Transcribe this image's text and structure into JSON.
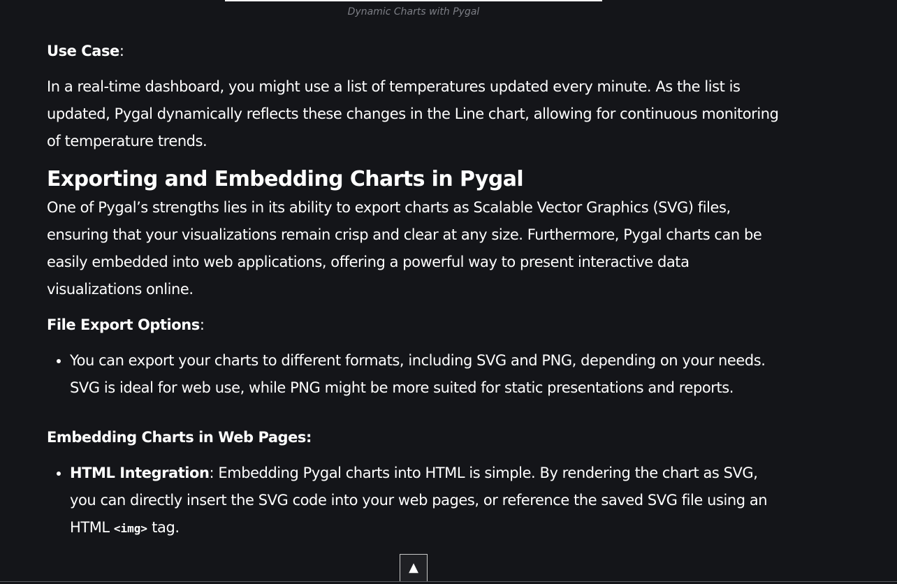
{
  "figure": {
    "caption": "Dynamic Charts with Pygal"
  },
  "use_case": {
    "label": "Use Case",
    "colon": ":",
    "text": "In a real-time dashboard, you might use a list of temperatures updated every minute. As the list is updated, Pygal dynamically reflects these changes in the Line chart, allowing for continuous monitoring of temperature trends."
  },
  "export_section": {
    "heading": "Exporting and Embedding Charts in Pygal",
    "intro": "One of Pygal’s strengths lies in its ability to export charts as Scalable Vector Graphics (SVG) files, ensuring that your visualizations remain crisp and clear at any size. Furthermore, Pygal charts can be easily embedded into web applications, offering a powerful way to present interactive data visualizations online."
  },
  "file_export": {
    "label": "File Export Options",
    "colon": ":",
    "items": [
      "You can export your charts to different formats, including SVG and PNG, depending on your needs. SVG is ideal for web use, while PNG might be more suited for static presentations and reports."
    ]
  },
  "embedding": {
    "label": "Embedding Charts in Web Pages:",
    "items": [
      {
        "title": "HTML Integration",
        "text_before": ": Embedding Pygal charts into HTML is simple. By rendering the chart as SVG, you can directly insert the SVG code into your web pages, or reference the saved SVG file using an HTML ",
        "code": "<img>",
        "text_after": " tag."
      }
    ]
  },
  "controls": {
    "back_to_top": "▲"
  }
}
